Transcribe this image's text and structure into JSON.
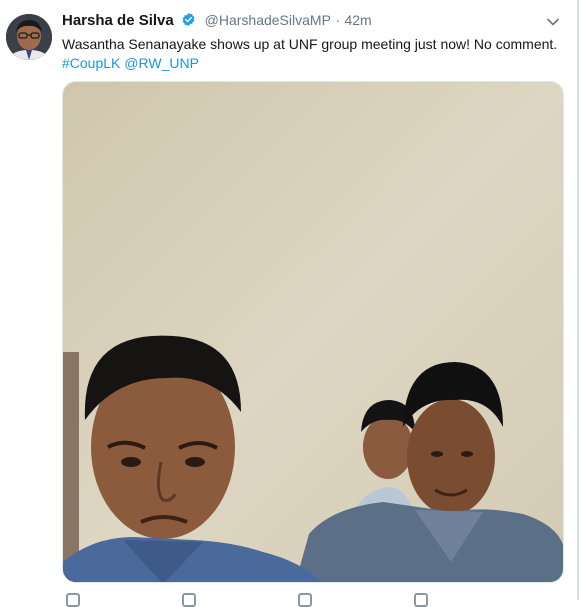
{
  "tweet": {
    "author_name": "Harsha de Silva",
    "author_handle": "@HarshadeSilvaMP",
    "separator": "·",
    "time": "42m",
    "text": "Wasantha Senanayake shows up at UNF group meeting just now! No comment.",
    "hashtag": "#CoupLK",
    "mention": "@RW_UNP"
  },
  "icons": {
    "verified": "verified-badge-icon",
    "caret": "chevron-down-icon",
    "reply": "reply-icon",
    "retweet": "retweet-icon",
    "like": "like-icon",
    "share": "share-icon"
  },
  "colors": {
    "link": "#1b95e0",
    "verified": "#1da1f2",
    "secondary_text": "#657786"
  }
}
